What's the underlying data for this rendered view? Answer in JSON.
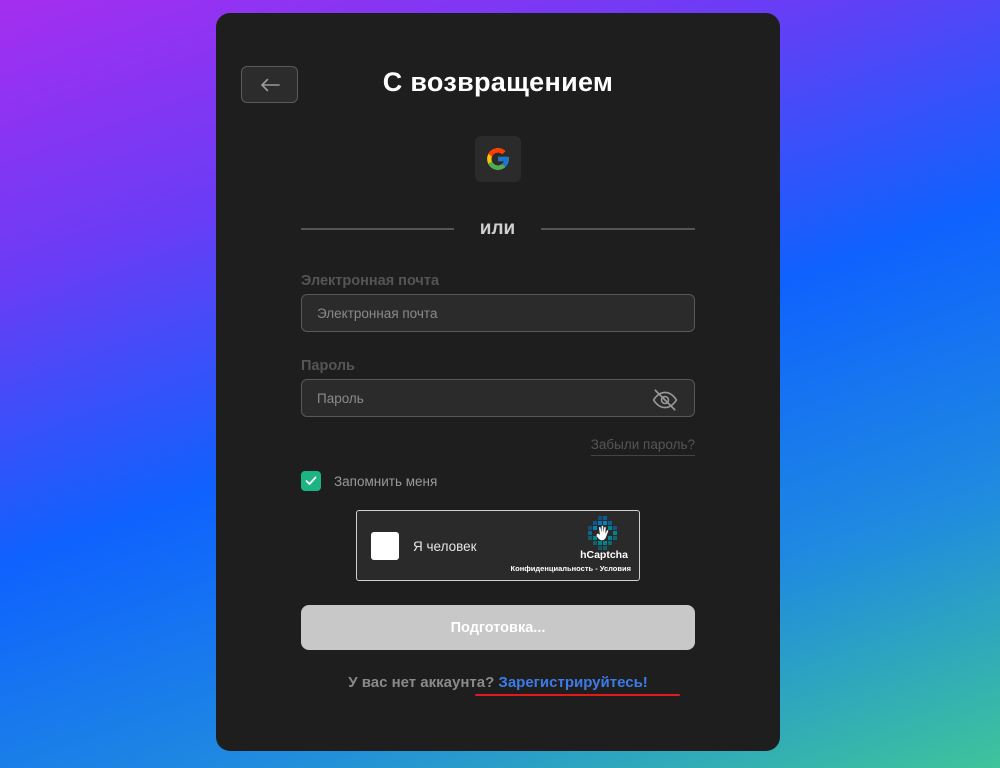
{
  "header": {
    "title": "С возвращением",
    "back_icon": "arrow-left-icon"
  },
  "social": {
    "google_icon": "google-logo-icon"
  },
  "divider": {
    "text": "или"
  },
  "email": {
    "label": "Электронная почта",
    "placeholder": "Электронная почта",
    "value": ""
  },
  "password": {
    "label": "Пароль",
    "placeholder": "Пароль",
    "value": "",
    "toggle_icon": "eye-off-icon"
  },
  "forgot_link": "Забыли пароль?",
  "remember": {
    "label": "Запомнить меня",
    "checked": true
  },
  "captcha": {
    "label": "Я человек",
    "brand": "hCaptcha",
    "privacy": "Конфиденциальность",
    "separator": " - ",
    "terms": "Условия"
  },
  "submit_label": "Подготовка...",
  "signup": {
    "question": "У вас нет аккаунта? ",
    "link": "Зарегистрируйтесь!"
  },
  "colors": {
    "accent_green": "#1cb482",
    "link_blue": "#3d7be8",
    "highlight_red": "#e11b1b",
    "card_bg": "#1e1e1e"
  }
}
